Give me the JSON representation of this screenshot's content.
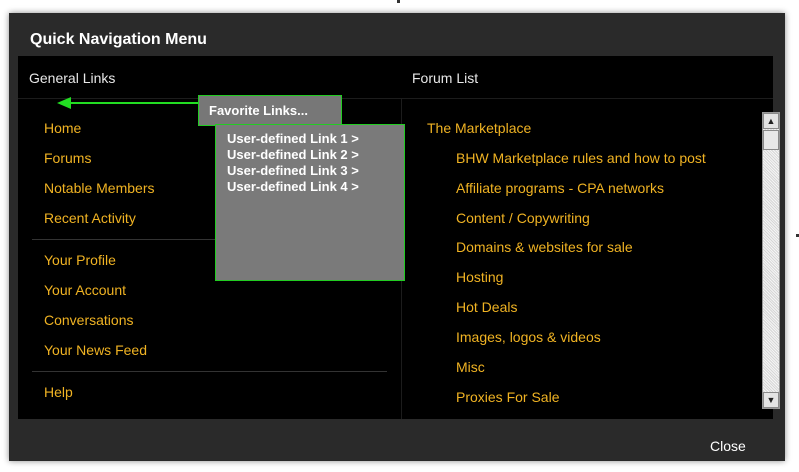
{
  "window": {
    "title": "Quick Navigation Menu",
    "close_label": "Close"
  },
  "general": {
    "header": "General Links",
    "group1": [
      "Home",
      "Forums",
      "Notable Members",
      "Recent Activity"
    ],
    "group2": [
      "Your Profile",
      "Your Account",
      "Conversations",
      "Your News Feed"
    ],
    "group3": [
      "Help"
    ]
  },
  "forum": {
    "header": "Forum List",
    "parent": "The Marketplace",
    "children": [
      "BHW Marketplace rules and how to post",
      "Affiliate programs - CPA networks",
      "Content / Copywriting",
      "Domains & websites for sale",
      "Hosting",
      "Hot Deals",
      "Images, logos & videos",
      "Misc",
      "Proxies For Sale"
    ]
  },
  "favorites": {
    "label": "Favorite Links...",
    "links": [
      "User-defined Link 1 >",
      "User-defined Link 2 >",
      "User-defined Link 3 >",
      "User-defined Link 4 >"
    ]
  },
  "colors": {
    "link": "#f0b323",
    "panel": "#000000",
    "frame": "#2a2a2a",
    "highlight_border": "#22cc22",
    "arrow": "#22dd22",
    "popup_bg": "#777777"
  },
  "scrollbar": {
    "up_icon": "arrow-up-icon",
    "down_icon": "arrow-down-icon"
  }
}
